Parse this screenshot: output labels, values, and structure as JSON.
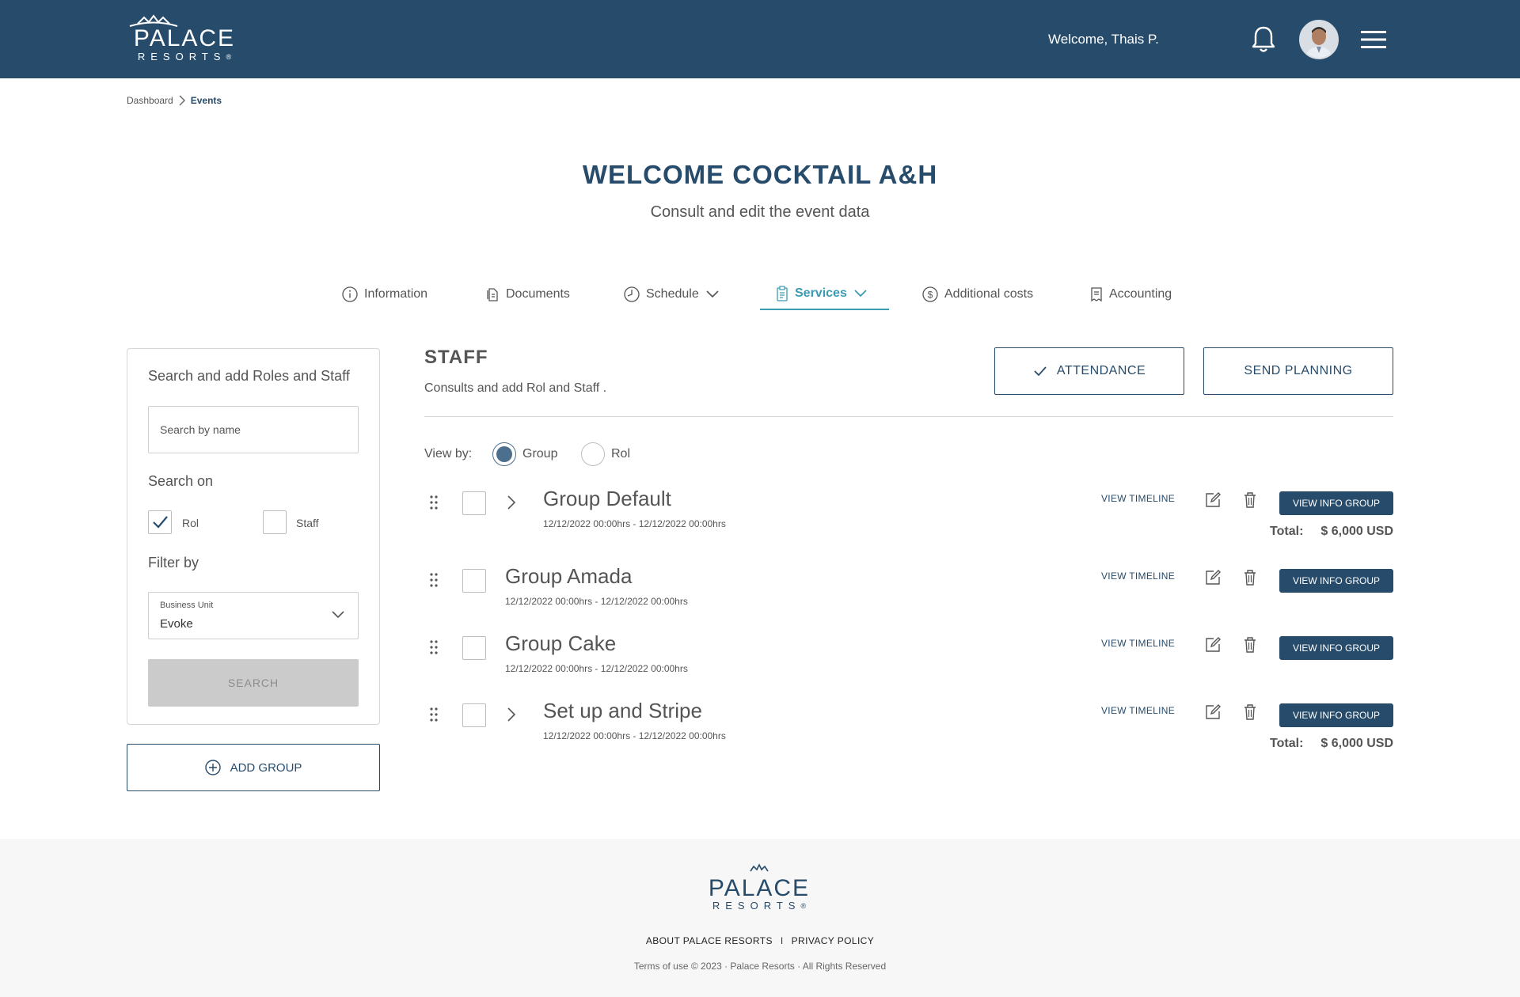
{
  "header": {
    "logo_main": "PALACE",
    "logo_sub": "RESORTS",
    "logo_mark": "®",
    "welcome": "Welcome, Thais P.",
    "bell_icon": "bell-icon",
    "menu_icon": "hamburger-menu-icon"
  },
  "breadcrumb": {
    "items": [
      "Dashboard",
      "Events"
    ]
  },
  "page": {
    "title": "WELCOME COCKTAIL A&H",
    "subtitle": "Consult and edit the event data"
  },
  "tabs": [
    {
      "label": "Information",
      "icon": "info-icon"
    },
    {
      "label": "Documents",
      "icon": "documents-icon"
    },
    {
      "label": "Schedule",
      "icon": "clock-icon"
    },
    {
      "label": "Services",
      "icon": "clipboard-icon",
      "active": true
    },
    {
      "label": "Additional costs",
      "icon": "dollar-icon"
    },
    {
      "label": "Accounting",
      "icon": "receipt-icon"
    }
  ],
  "search_panel": {
    "title": "Search and add Roles and Staff",
    "search_placeholder": "Search by name",
    "search_on_label": "Search on",
    "options": [
      {
        "label": "Rol",
        "checked": true
      },
      {
        "label": "Staff",
        "checked": false
      }
    ],
    "filter_label": "Filter by",
    "business_unit_label": "Business Unit",
    "business_unit_value": "Evoke",
    "search_button": "SEARCH"
  },
  "add_group": "ADD GROUP",
  "staff": {
    "title": "STAFF",
    "subtitle": "Consults and add Rol and Staff .",
    "attendance_button": "ATTENDANCE",
    "send_planning_button": "SEND PLANNING",
    "view_by_label": "View by:",
    "view_by_options": [
      {
        "label": "Group",
        "selected": true
      },
      {
        "label": "Rol",
        "selected": false
      }
    ]
  },
  "groups": [
    {
      "name": "Group Default",
      "dates": "12/12/2022 00:00hrs - 12/12/2022 00:00hrs",
      "expandable": true,
      "timeline": "VIEW TIMELINE",
      "info_button": "VIEW INFO GROUP",
      "total_label": "Total:",
      "total": "$ 6,000 USD"
    },
    {
      "name": "Group Amada",
      "dates": "12/12/2022 00:00hrs - 12/12/2022 00:00hrs",
      "expandable": false,
      "timeline": "VIEW TIMELINE",
      "info_button": "VIEW INFO GROUP"
    },
    {
      "name": "Group Cake",
      "dates": "12/12/2022 00:00hrs - 12/12/2022 00:00hrs",
      "expandable": false,
      "timeline": "VIEW TIMELINE",
      "info_button": "VIEW INFO GROUP"
    },
    {
      "name": "Set up and Stripe",
      "dates": "12/12/2022 00:00hrs - 12/12/2022 00:00hrs",
      "expandable": true,
      "timeline": "VIEW TIMELINE",
      "info_button": "VIEW INFO GROUP",
      "total_label": "Total:",
      "total": "$ 6,000 USD"
    }
  ],
  "footer": {
    "logo_main": "PALACE",
    "logo_sub": "RESORTS",
    "logo_mark": "®",
    "links": [
      "ABOUT PALACE RESORTS",
      "PRIVACY POLICY"
    ],
    "separator": "I",
    "copyright": "Terms of use © 2023 · Palace Resorts · All Rights Reserved"
  },
  "colors": {
    "brand": "#274b6a",
    "accent": "#3a9bb2",
    "disabled": "#cbcbcb"
  }
}
